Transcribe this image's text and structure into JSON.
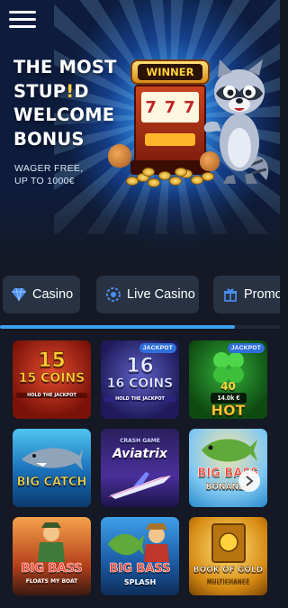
{
  "header": {
    "menu_icon": "hamburger-menu-icon"
  },
  "hero": {
    "title_line1": "THE MOST",
    "title_line2_a": "STUP",
    "title_line2_b": "!",
    "title_line2_c": "D",
    "title_line3": "WELCOME",
    "title_line4": "BONUS",
    "sub_line1": "WAGER FREE,",
    "sub_line2": "UP TO 1000€",
    "winner_label": "WINNER",
    "reel_symbols": [
      "7",
      "7",
      "7"
    ],
    "highlight_color": "#ffd23c"
  },
  "tabs": [
    {
      "label": "Casino",
      "icon": "diamond-icon"
    },
    {
      "label": "Live Casino",
      "icon": "poker-chip-icon"
    },
    {
      "label": "Promo",
      "icon": "gift-icon"
    }
  ],
  "scroll_progress": 0.84,
  "games": [
    {
      "name": "15 COINS",
      "subtitle": "HOLD THE JACKPOT",
      "badge": "",
      "jackpot_amount": ""
    },
    {
      "name": "16 COINS",
      "subtitle": "HOLD THE JACKPOT",
      "badge": "JACKPOT",
      "jackpot_amount": ""
    },
    {
      "name": "HOT",
      "subtitle": "",
      "badge": "JACKPOT",
      "jackpot_amount": "14.0k €"
    },
    {
      "name": "BIG CATCH",
      "subtitle": "",
      "badge": "",
      "jackpot_amount": ""
    },
    {
      "name": "Aviatrix",
      "subtitle": "CRASH GAME",
      "badge": "",
      "jackpot_amount": ""
    },
    {
      "name": "BIG BASS",
      "subtitle": "BONANZA",
      "badge": "",
      "jackpot_amount": ""
    },
    {
      "name": "BIG BASS",
      "subtitle": "FLOATS MY BOAT",
      "badge": "",
      "jackpot_amount": ""
    },
    {
      "name": "BIG BASS",
      "subtitle": "SPLASH",
      "badge": "",
      "jackpot_amount": ""
    },
    {
      "name": "BOOK OF GOLD",
      "subtitle": "MULTICHANCE",
      "badge": "",
      "jackpot_amount": ""
    }
  ]
}
